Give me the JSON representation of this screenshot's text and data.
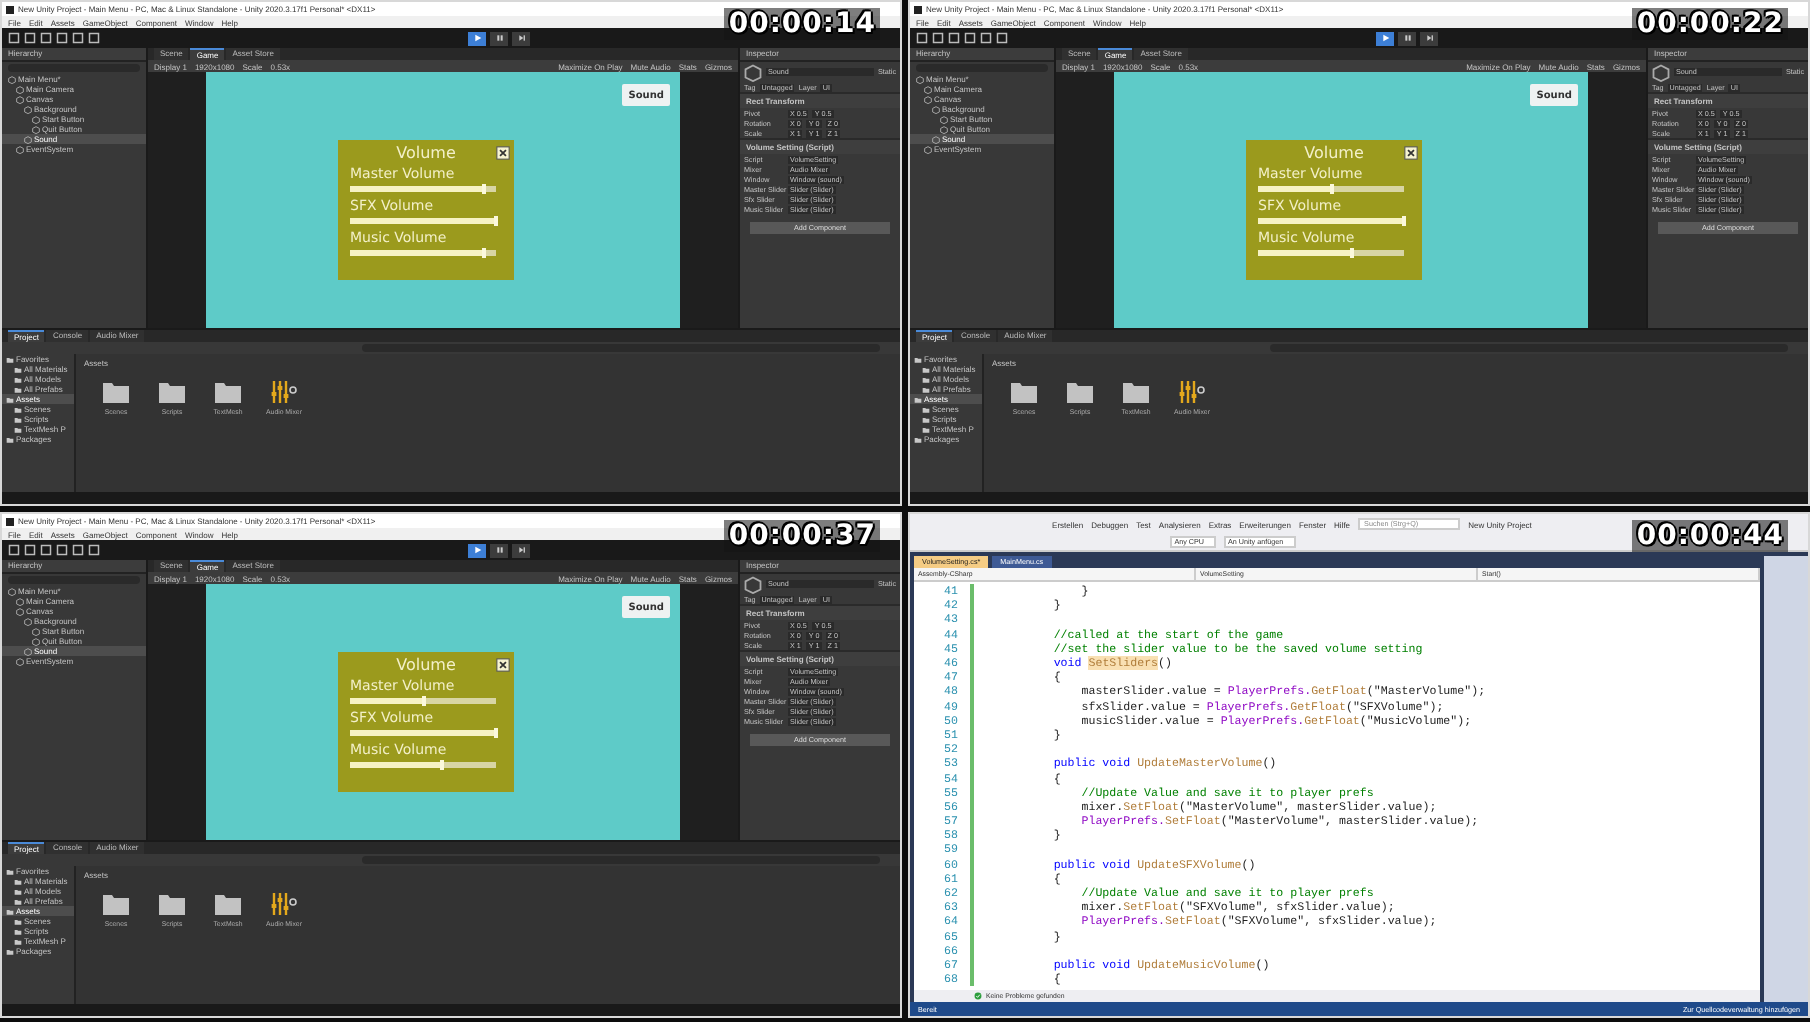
{
  "recordings": [
    {
      "kind": "unity",
      "timestamp": "00:00:14",
      "title": "New Unity Project - Main Menu - PC, Mac & Linux Standalone - Unity 2020.3.17f1 Personal* <DX11>",
      "menu": [
        "File",
        "Edit",
        "Assets",
        "GameObject",
        "Component",
        "Window",
        "Help"
      ],
      "playing": true,
      "hierarchy": {
        "tab": "Hierarchy",
        "items": [
          {
            "label": "Main Menu*",
            "selected": false,
            "children": [
              {
                "label": "Main Camera",
                "selected": false
              },
              {
                "label": "Canvas",
                "selected": false,
                "children": [
                  {
                    "label": "Background",
                    "selected": false,
                    "children": [
                      {
                        "label": "Start Button",
                        "selected": false
                      },
                      {
                        "label": "Quit Button",
                        "selected": false
                      }
                    ]
                  },
                  {
                    "label": "Sound",
                    "selected": true
                  }
                ]
              },
              {
                "label": "EventSystem",
                "selected": false
              }
            ]
          }
        ]
      },
      "view_tabs": [
        {
          "label": "Scene",
          "selected": false
        },
        {
          "label": "Game",
          "selected": true
        },
        {
          "label": "Asset Store",
          "selected": false
        }
      ],
      "game_toolbar": {
        "left": [
          "Display 1",
          "1920x1080",
          "Scale",
          "0.53x"
        ],
        "right": [
          "Maximize On Play",
          "Mute Audio",
          "Stats",
          "Gizmos"
        ]
      },
      "game": {
        "sound_button": "Sound",
        "panel_title": "Volume",
        "sliders": [
          {
            "label": "Master Volume",
            "level": 0.92
          },
          {
            "label": "SFX Volume",
            "level": 1.0
          },
          {
            "label": "Music Volume",
            "level": 0.92
          }
        ]
      },
      "inspector": {
        "tab": "Inspector",
        "object_name": "Sound",
        "static_label": "Static",
        "tag_label": "Tag",
        "tag": "Untagged",
        "layer_label": "Layer",
        "layer": "UI",
        "components": [
          {
            "title": "Rect Transform",
            "rows": [
              {
                "label": "Pivot",
                "values": [
                  "X 0.5",
                  "Y 0.5"
                ]
              },
              {
                "label": "Rotation",
                "values": [
                  "X 0",
                  "Y 0",
                  "Z 0"
                ]
              },
              {
                "label": "Scale",
                "values": [
                  "X 1",
                  "Y 1",
                  "Z 1"
                ]
              }
            ]
          },
          {
            "title": "Volume Setting (Script)",
            "rows": [
              {
                "label": "Script",
                "values": [
                  "VolumeSetting"
                ]
              },
              {
                "label": "Mixer",
                "values": [
                  "Audio Mixer"
                ]
              },
              {
                "label": "Window",
                "values": [
                  "Window (sound)"
                ]
              },
              {
                "label": "Master Slider",
                "values": [
                  "Slider (Slider)"
                ]
              },
              {
                "label": "Sfx Slider",
                "values": [
                  "Slider (Slider)"
                ]
              },
              {
                "label": "Music Slider",
                "values": [
                  "Slider (Slider)"
                ]
              }
            ]
          }
        ],
        "add_component": "Add Component"
      },
      "project": {
        "tabs": [
          {
            "label": "Project",
            "selected": true
          },
          {
            "label": "Console",
            "selected": false
          },
          {
            "label": "Audio Mixer",
            "selected": false
          }
        ],
        "tree": [
          {
            "label": "Favorites",
            "selected": false,
            "children": [
              {
                "label": "All Materials",
                "selected": false
              },
              {
                "label": "All Models",
                "selected": false
              },
              {
                "label": "All Prefabs",
                "selected": false
              }
            ]
          },
          {
            "label": "Assets",
            "selected": true,
            "children": [
              {
                "label": "Scenes",
                "selected": false
              },
              {
                "label": "Scripts",
                "selected": false
              },
              {
                "label": "TextMesh P",
                "selected": false
              }
            ]
          },
          {
            "label": "Packages",
            "selected": false
          }
        ],
        "breadcrumb": "Assets",
        "items": [
          {
            "label": "Scenes",
            "kind": "folder"
          },
          {
            "label": "Scripts",
            "kind": "folder"
          },
          {
            "label": "TextMesh",
            "kind": "folder"
          },
          {
            "label": "Audio Mixer",
            "kind": "mixer"
          }
        ]
      }
    },
    {
      "kind": "unity",
      "timestamp": "00:00:22",
      "title": "New Unity Project - Main Menu - PC, Mac & Linux Standalone - Unity 2020.3.17f1 Personal* <DX11>",
      "menu": [
        "File",
        "Edit",
        "Assets",
        "GameObject",
        "Component",
        "Window",
        "Help"
      ],
      "playing": true,
      "hierarchy": {
        "tab": "Hierarchy",
        "items": [
          {
            "label": "Main Menu*",
            "selected": false,
            "children": [
              {
                "label": "Main Camera",
                "selected": false
              },
              {
                "label": "Canvas",
                "selected": false,
                "children": [
                  {
                    "label": "Background",
                    "selected": false,
                    "children": [
                      {
                        "label": "Start Button",
                        "selected": false
                      },
                      {
                        "label": "Quit Button",
                        "selected": false
                      }
                    ]
                  },
                  {
                    "label": "Sound",
                    "selected": true
                  }
                ]
              },
              {
                "label": "EventSystem",
                "selected": false
              }
            ]
          }
        ]
      },
      "view_tabs": [
        {
          "label": "Scene",
          "selected": false
        },
        {
          "label": "Game",
          "selected": true
        },
        {
          "label": "Asset Store",
          "selected": false
        }
      ],
      "game_toolbar": {
        "left": [
          "Display 1",
          "1920x1080",
          "Scale",
          "0.53x"
        ],
        "right": [
          "Maximize On Play",
          "Mute Audio",
          "Stats",
          "Gizmos"
        ]
      },
      "game": {
        "sound_button": "Sound",
        "panel_title": "Volume",
        "sliders": [
          {
            "label": "Master Volume",
            "level": 0.5
          },
          {
            "label": "SFX Volume",
            "level": 1.0
          },
          {
            "label": "Music Volume",
            "level": 0.64
          }
        ]
      },
      "inspector": {
        "tab": "Inspector",
        "object_name": "Sound",
        "static_label": "Static",
        "tag_label": "Tag",
        "tag": "Untagged",
        "layer_label": "Layer",
        "layer": "UI",
        "components": [
          {
            "title": "Rect Transform",
            "rows": [
              {
                "label": "Pivot",
                "values": [
                  "X 0.5",
                  "Y 0.5"
                ]
              },
              {
                "label": "Rotation",
                "values": [
                  "X 0",
                  "Y 0",
                  "Z 0"
                ]
              },
              {
                "label": "Scale",
                "values": [
                  "X 1",
                  "Y 1",
                  "Z 1"
                ]
              }
            ]
          },
          {
            "title": "Volume Setting (Script)",
            "rows": [
              {
                "label": "Script",
                "values": [
                  "VolumeSetting"
                ]
              },
              {
                "label": "Mixer",
                "values": [
                  "Audio Mixer"
                ]
              },
              {
                "label": "Window",
                "values": [
                  "Window (sound)"
                ]
              },
              {
                "label": "Master Slider",
                "values": [
                  "Slider (Slider)"
                ]
              },
              {
                "label": "Sfx Slider",
                "values": [
                  "Slider (Slider)"
                ]
              },
              {
                "label": "Music Slider",
                "values": [
                  "Slider (Slider)"
                ]
              }
            ]
          }
        ],
        "add_component": "Add Component"
      },
      "project": {
        "tabs": [
          {
            "label": "Project",
            "selected": true
          },
          {
            "label": "Console",
            "selected": false
          },
          {
            "label": "Audio Mixer",
            "selected": false
          }
        ],
        "tree": [
          {
            "label": "Favorites",
            "selected": false,
            "children": [
              {
                "label": "All Materials",
                "selected": false
              },
              {
                "label": "All Models",
                "selected": false
              },
              {
                "label": "All Prefabs",
                "selected": false
              }
            ]
          },
          {
            "label": "Assets",
            "selected": true,
            "children": [
              {
                "label": "Scenes",
                "selected": false
              },
              {
                "label": "Scripts",
                "selected": false
              },
              {
                "label": "TextMesh P",
                "selected": false
              }
            ]
          },
          {
            "label": "Packages",
            "selected": false
          }
        ],
        "breadcrumb": "Assets",
        "items": [
          {
            "label": "Scenes",
            "kind": "folder"
          },
          {
            "label": "Scripts",
            "kind": "folder"
          },
          {
            "label": "TextMesh",
            "kind": "folder"
          },
          {
            "label": "Audio Mixer",
            "kind": "mixer"
          }
        ]
      }
    },
    {
      "kind": "unity",
      "timestamp": "00:00:37",
      "title": "New Unity Project - Main Menu - PC, Mac & Linux Standalone - Unity 2020.3.17f1 Personal* <DX11>",
      "menu": [
        "File",
        "Edit",
        "Assets",
        "GameObject",
        "Component",
        "Window",
        "Help"
      ],
      "playing": true,
      "hierarchy": {
        "tab": "Hierarchy",
        "items": [
          {
            "label": "Main Menu*",
            "selected": false,
            "children": [
              {
                "label": "Main Camera",
                "selected": false
              },
              {
                "label": "Canvas",
                "selected": false,
                "children": [
                  {
                    "label": "Background",
                    "selected": false,
                    "children": [
                      {
                        "label": "Start Button",
                        "selected": false
                      },
                      {
                        "label": "Quit Button",
                        "selected": false
                      }
                    ]
                  },
                  {
                    "label": "Sound",
                    "selected": true
                  }
                ]
              },
              {
                "label": "EventSystem",
                "selected": false
              }
            ]
          }
        ]
      },
      "view_tabs": [
        {
          "label": "Scene",
          "selected": false
        },
        {
          "label": "Game",
          "selected": true
        },
        {
          "label": "Asset Store",
          "selected": false
        }
      ],
      "game_toolbar": {
        "left": [
          "Display 1",
          "1920x1080",
          "Scale",
          "0.53x"
        ],
        "right": [
          "Maximize On Play",
          "Mute Audio",
          "Stats",
          "Gizmos"
        ]
      },
      "game": {
        "sound_button": "Sound",
        "panel_title": "Volume",
        "sliders": [
          {
            "label": "Master Volume",
            "level": 0.5
          },
          {
            "label": "SFX Volume",
            "level": 1.0
          },
          {
            "label": "Music Volume",
            "level": 0.63
          }
        ]
      },
      "inspector": {
        "tab": "Inspector",
        "object_name": "Sound",
        "static_label": "Static",
        "tag_label": "Tag",
        "tag": "Untagged",
        "layer_label": "Layer",
        "layer": "UI",
        "components": [
          {
            "title": "Rect Transform",
            "rows": [
              {
                "label": "Pivot",
                "values": [
                  "X 0.5",
                  "Y 0.5"
                ]
              },
              {
                "label": "Rotation",
                "values": [
                  "X 0",
                  "Y 0",
                  "Z 0"
                ]
              },
              {
                "label": "Scale",
                "values": [
                  "X 1",
                  "Y 1",
                  "Z 1"
                ]
              }
            ]
          },
          {
            "title": "Volume Setting (Script)",
            "rows": [
              {
                "label": "Script",
                "values": [
                  "VolumeSetting"
                ]
              },
              {
                "label": "Mixer",
                "values": [
                  "Audio Mixer"
                ]
              },
              {
                "label": "Window",
                "values": [
                  "Window (sound)"
                ]
              },
              {
                "label": "Master Slider",
                "values": [
                  "Slider (Slider)"
                ]
              },
              {
                "label": "Sfx Slider",
                "values": [
                  "Slider (Slider)"
                ]
              },
              {
                "label": "Music Slider",
                "values": [
                  "Slider (Slider)"
                ]
              }
            ]
          }
        ],
        "add_component": "Add Component"
      },
      "project": {
        "tabs": [
          {
            "label": "Project",
            "selected": true
          },
          {
            "label": "Console",
            "selected": false
          },
          {
            "label": "Audio Mixer",
            "selected": false
          }
        ],
        "tree": [
          {
            "label": "Favorites",
            "selected": false,
            "children": [
              {
                "label": "All Materials",
                "selected": false
              },
              {
                "label": "All Models",
                "selected": false
              },
              {
                "label": "All Prefabs",
                "selected": false
              }
            ]
          },
          {
            "label": "Assets",
            "selected": true,
            "children": [
              {
                "label": "Scenes",
                "selected": false
              },
              {
                "label": "Scripts",
                "selected": false
              },
              {
                "label": "TextMesh P",
                "selected": false
              }
            ]
          },
          {
            "label": "Packages",
            "selected": false
          }
        ],
        "breadcrumb": "Assets",
        "items": [
          {
            "label": "Scenes",
            "kind": "folder"
          },
          {
            "label": "Scripts",
            "kind": "folder"
          },
          {
            "label": "TextMesh",
            "kind": "folder"
          },
          {
            "label": "Audio Mixer",
            "kind": "mixer"
          }
        ]
      }
    },
    {
      "kind": "code_editor",
      "timestamp": "00:00:44",
      "menu": [
        "Erstellen",
        "Debuggen",
        "Test",
        "Analysieren",
        "Extras",
        "Erweiterungen",
        "Fenster",
        "Hilfe"
      ],
      "search_placeholder": "Suchen (Strg+Q)",
      "project_name": "New Unity Project",
      "toolbar": [
        "Any CPU",
        "An Unity anfügen"
      ],
      "tabs": [
        {
          "label": "VolumeSetting.cs*",
          "selected": true
        },
        {
          "label": "MainMenu.cs",
          "selected": false
        }
      ],
      "nav": [
        "Assembly-CSharp",
        "VolumeSetting",
        "Start()"
      ],
      "lines": [
        {
          "number": "41",
          "segments": [
            {
              "text": "            }",
              "kind": "plain"
            }
          ]
        },
        {
          "number": "42",
          "segments": [
            {
              "text": "        }",
              "kind": "plain"
            }
          ]
        },
        {
          "number": "43"
        },
        {
          "number": "44",
          "segments": [
            {
              "text": "        //called at the start of the game",
              "kind": "comment"
            }
          ]
        },
        {
          "number": "45",
          "segments": [
            {
              "text": "        //set the slider value to be the saved volume setting",
              "kind": "comment"
            }
          ]
        },
        {
          "number": "46",
          "segments": [
            {
              "text": "        void ",
              "kind": "keyword"
            },
            {
              "text": "SetSliders",
              "kind": "highlight"
            },
            {
              "text": "()",
              "kind": "plain"
            }
          ]
        },
        {
          "number": "47",
          "segments": [
            {
              "text": "        {",
              "kind": "plain"
            }
          ]
        },
        {
          "number": "48",
          "segments": [
            {
              "text": "            masterSlider.value = ",
              "kind": "plain"
            },
            {
              "text": "PlayerPrefs.",
              "kind": "type"
            },
            {
              "text": "GetFloat",
              "kind": "method"
            },
            {
              "text": "(\"MasterVolume\");",
              "kind": "plain"
            }
          ]
        },
        {
          "number": "49",
          "segments": [
            {
              "text": "            sfxSlider.value = ",
              "kind": "plain"
            },
            {
              "text": "PlayerPrefs.",
              "kind": "type"
            },
            {
              "text": "GetFloat",
              "kind": "method"
            },
            {
              "text": "(\"SFXVolume\");",
              "kind": "plain"
            }
          ]
        },
        {
          "number": "50",
          "segments": [
            {
              "text": "            musicSlider.value = ",
              "kind": "plain"
            },
            {
              "text": "PlayerPrefs.",
              "kind": "type"
            },
            {
              "text": "GetFloat",
              "kind": "method"
            },
            {
              "text": "(\"MusicVolume\");",
              "kind": "plain"
            }
          ]
        },
        {
          "number": "51",
          "segments": [
            {
              "text": "        }",
              "kind": "plain"
            }
          ]
        },
        {
          "number": "52"
        },
        {
          "number": "53",
          "segments": [
            {
              "text": "        public void ",
              "kind": "keyword"
            },
            {
              "text": "UpdateMasterVolume",
              "kind": "method"
            },
            {
              "text": "()",
              "kind": "plain"
            }
          ]
        },
        {
          "number": "54",
          "segments": [
            {
              "text": "        {",
              "kind": "plain"
            }
          ]
        },
        {
          "number": "55",
          "segments": [
            {
              "text": "            //Update Value and save it to player prefs",
              "kind": "comment"
            }
          ]
        },
        {
          "number": "56",
          "segments": [
            {
              "text": "            mixer.",
              "kind": "plain"
            },
            {
              "text": "SetFloat",
              "kind": "method"
            },
            {
              "text": "(\"MasterVolume\", masterSlider.value);",
              "kind": "plain"
            }
          ]
        },
        {
          "number": "57",
          "segments": [
            {
              "text": "            PlayerPrefs.",
              "kind": "type"
            },
            {
              "text": "SetFloat",
              "kind": "method"
            },
            {
              "text": "(\"MasterVolume\", masterSlider.value);",
              "kind": "plain"
            }
          ]
        },
        {
          "number": "58",
          "segments": [
            {
              "text": "        }",
              "kind": "plain"
            }
          ]
        },
        {
          "number": "59"
        },
        {
          "number": "60",
          "segments": [
            {
              "text": "        public void ",
              "kind": "keyword"
            },
            {
              "text": "UpdateSFXVolume",
              "kind": "method"
            },
            {
              "text": "()",
              "kind": "plain"
            }
          ]
        },
        {
          "number": "61",
          "segments": [
            {
              "text": "        {",
              "kind": "plain"
            }
          ]
        },
        {
          "number": "62",
          "segments": [
            {
              "text": "            //Update Value and save it to player prefs",
              "kind": "comment"
            }
          ]
        },
        {
          "number": "63",
          "segments": [
            {
              "text": "            mixer.",
              "kind": "plain"
            },
            {
              "text": "SetFloat",
              "kind": "method"
            },
            {
              "text": "(\"SFXVolume\", sfxSlider.value);",
              "kind": "plain"
            }
          ]
        },
        {
          "number": "64",
          "segments": [
            {
              "text": "            PlayerPrefs.",
              "kind": "type"
            },
            {
              "text": "SetFloat",
              "kind": "method"
            },
            {
              "text": "(\"SFXVolume\", sfxSlider.value);",
              "kind": "plain"
            }
          ]
        },
        {
          "number": "65",
          "segments": [
            {
              "text": "        }",
              "kind": "plain"
            }
          ]
        },
        {
          "number": "66"
        },
        {
          "number": "67",
          "segments": [
            {
              "text": "        public void ",
              "kind": "keyword"
            },
            {
              "text": "UpdateMusicVolume",
              "kind": "method"
            },
            {
              "text": "()",
              "kind": "plain"
            }
          ]
        },
        {
          "number": "68",
          "segments": [
            {
              "text": "        {",
              "kind": "plain"
            }
          ]
        }
      ],
      "problems": "Keine Probleme gefunden",
      "status": "Bereit",
      "source_control": "Zur Quellcodeverwaltung hinzufügen"
    }
  ]
}
